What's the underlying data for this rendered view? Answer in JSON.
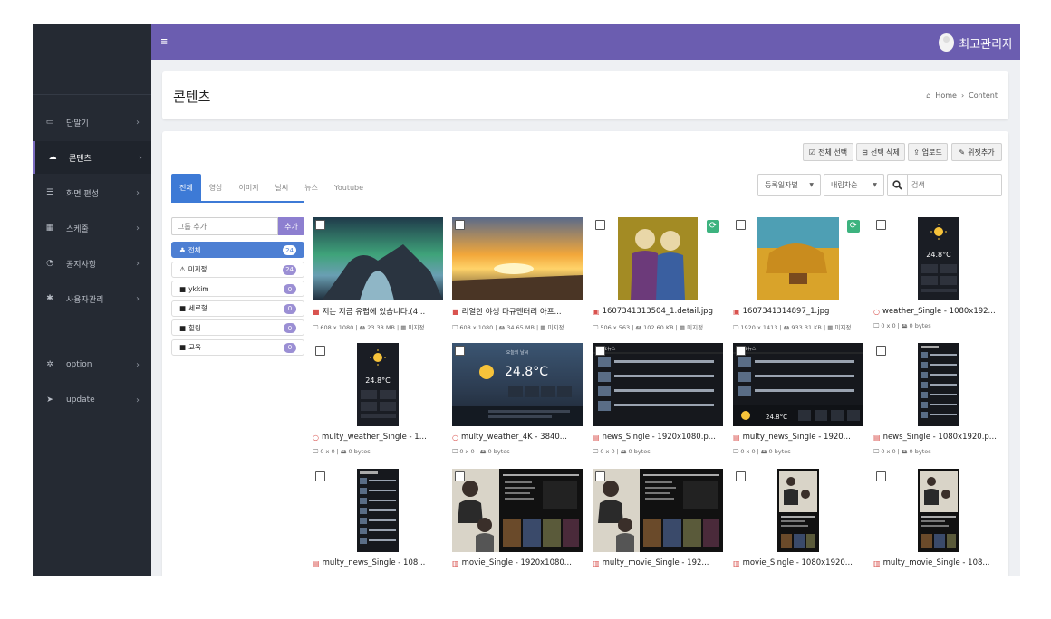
{
  "user": {
    "name": "최고관리자"
  },
  "sidebar": {
    "items": [
      {
        "icon": "monitor-icon",
        "glyph": "▭",
        "label": "단말기"
      },
      {
        "icon": "cloud-icon",
        "glyph": "☁",
        "label": "콘텐츠"
      },
      {
        "icon": "list-icon",
        "glyph": "☰",
        "label": "화면 편성"
      },
      {
        "icon": "table-icon",
        "glyph": "▦",
        "label": "스케줄"
      },
      {
        "icon": "dashboard-icon",
        "glyph": "◔",
        "label": "공지사항"
      },
      {
        "icon": "users-icon",
        "glyph": "✱",
        "label": "사용자관리"
      },
      {
        "icon": "gear-icon",
        "glyph": "✲",
        "label": "option"
      },
      {
        "icon": "send-icon",
        "glyph": "➤",
        "label": "update"
      }
    ]
  },
  "header": {
    "title": "콘텐츠",
    "breadcrumb_home": "Home",
    "breadcrumb_current": "Content"
  },
  "toolbar": {
    "select_all": "전체 선택",
    "delete_selected": "선택 삭제",
    "upload": "업로드",
    "add_widget": "위젯추가"
  },
  "tabs": [
    "전체",
    "영상",
    "이미지",
    "날씨",
    "뉴스",
    "Youtube"
  ],
  "filters": {
    "sort_by": "등록일자별",
    "order": "내림차순",
    "search_placeholder": "검색"
  },
  "groups": {
    "add_placeholder": "그룹 추가",
    "add_button": "추가",
    "list": [
      {
        "icon": "sitemap-icon",
        "glyph": "♣",
        "name": "전체",
        "count": "24"
      },
      {
        "icon": "warning-icon",
        "glyph": "⚠",
        "name": "미지정",
        "count": "24"
      },
      {
        "icon": "folder-icon",
        "glyph": "■",
        "name": "ykkim",
        "count": "0"
      },
      {
        "icon": "folder-icon",
        "glyph": "■",
        "name": "세로형",
        "count": "0"
      },
      {
        "icon": "folder-icon",
        "glyph": "■",
        "name": "힐링",
        "count": "0"
      },
      {
        "icon": "folder-icon",
        "glyph": "■",
        "name": "교육",
        "count": "0"
      }
    ]
  },
  "items": [
    {
      "type": "video",
      "type_icon": "video-icon",
      "glyph": "■",
      "title": "저는 지금 유럽에 있습니다.(4...",
      "meta": "🖵 608 x 1080 | 🖴 23.38 MB | ▦ 미지정",
      "thumb": "aurora",
      "sync": false
    },
    {
      "type": "video",
      "type_icon": "video-icon",
      "glyph": "■",
      "title": "리얼한 야생 다큐멘터리 아프...",
      "meta": "🖵 608 x 1080 | 🖴 34.65 MB | ▦ 미지정",
      "thumb": "sunset",
      "sync": false
    },
    {
      "type": "image",
      "type_icon": "image-file-icon",
      "glyph": "▣",
      "title": "1607341313504_1.detail.jpg",
      "meta": "🖵 506 x 563 | 🖴 102.60 KB | ▦ 미지정",
      "thumb": "painting1",
      "sync": true
    },
    {
      "type": "image",
      "type_icon": "image-file-icon",
      "glyph": "▣",
      "title": "1607341314897_1.jpg",
      "meta": "🖵 1920 x 1413 | 🖴 933.31 KB | ▦ 미지정",
      "thumb": "painting2",
      "sync": true
    },
    {
      "type": "weather",
      "type_icon": "weather-icon",
      "glyph": "○",
      "title": "weather_Single - 1080x192...",
      "meta": "🖵 0 x 0 | 🖴 0 bytes",
      "thumb": "weather-v",
      "sync": false
    },
    {
      "type": "weather",
      "type_icon": "weather-icon",
      "glyph": "○",
      "title": "multy_weather_Single - 1...",
      "meta": "🖵 0 x 0 | 🖴 0 bytes",
      "thumb": "weather-v",
      "sync": false
    },
    {
      "type": "weather",
      "type_icon": "weather-icon",
      "glyph": "○",
      "title": "multy_weather_4K - 3840...",
      "meta": "🖵 0 x 0 | 🖴 0 bytes",
      "thumb": "weather-h",
      "sync": false
    },
    {
      "type": "news",
      "type_icon": "news-icon",
      "glyph": "▤",
      "title": "news_Single - 1920x1080.p...",
      "meta": "🖵 0 x 0 | 🖴 0 bytes",
      "thumb": "news-h",
      "sync": false
    },
    {
      "type": "news",
      "type_icon": "news-icon",
      "glyph": "▤",
      "title": "multy_news_Single - 1920...",
      "meta": "🖵 0 x 0 | 🖴 0 bytes",
      "thumb": "news-h-weather",
      "sync": false
    },
    {
      "type": "news",
      "type_icon": "news-icon",
      "glyph": "▤",
      "title": "news_Single - 1080x1920.p...",
      "meta": "🖵 0 x 0 | 🖴 0 bytes",
      "thumb": "news-v",
      "sync": false
    },
    {
      "type": "news",
      "type_icon": "news-icon",
      "glyph": "▤",
      "title": "multy_news_Single - 108...",
      "meta": "",
      "thumb": "news-v",
      "sync": false
    },
    {
      "type": "movie",
      "type_icon": "movie-icon",
      "glyph": "▥",
      "title": "movie_Single - 1920x1080...",
      "meta": "",
      "thumb": "movie-h",
      "sync": false
    },
    {
      "type": "movie",
      "type_icon": "movie-icon",
      "glyph": "▥",
      "title": "multy_movie_Single - 192...",
      "meta": "",
      "thumb": "movie-h",
      "sync": false
    },
    {
      "type": "movie",
      "type_icon": "movie-icon",
      "glyph": "▥",
      "title": "movie_Single - 1080x1920...",
      "meta": "",
      "thumb": "movie-v",
      "sync": false
    },
    {
      "type": "movie",
      "type_icon": "movie-icon",
      "glyph": "▥",
      "title": "multy_movie_Single - 108...",
      "meta": "",
      "thumb": "movie-v",
      "sync": false
    }
  ],
  "thumb_text": {
    "temp": "24.8°C",
    "weather_title": "오늘의 날씨",
    "news_title": "주요뉴스"
  },
  "colors": {
    "accent": "#6b5db0",
    "tab_active": "#3d7ad6",
    "sidebar": "#252a33",
    "sync": "#3db37f"
  }
}
